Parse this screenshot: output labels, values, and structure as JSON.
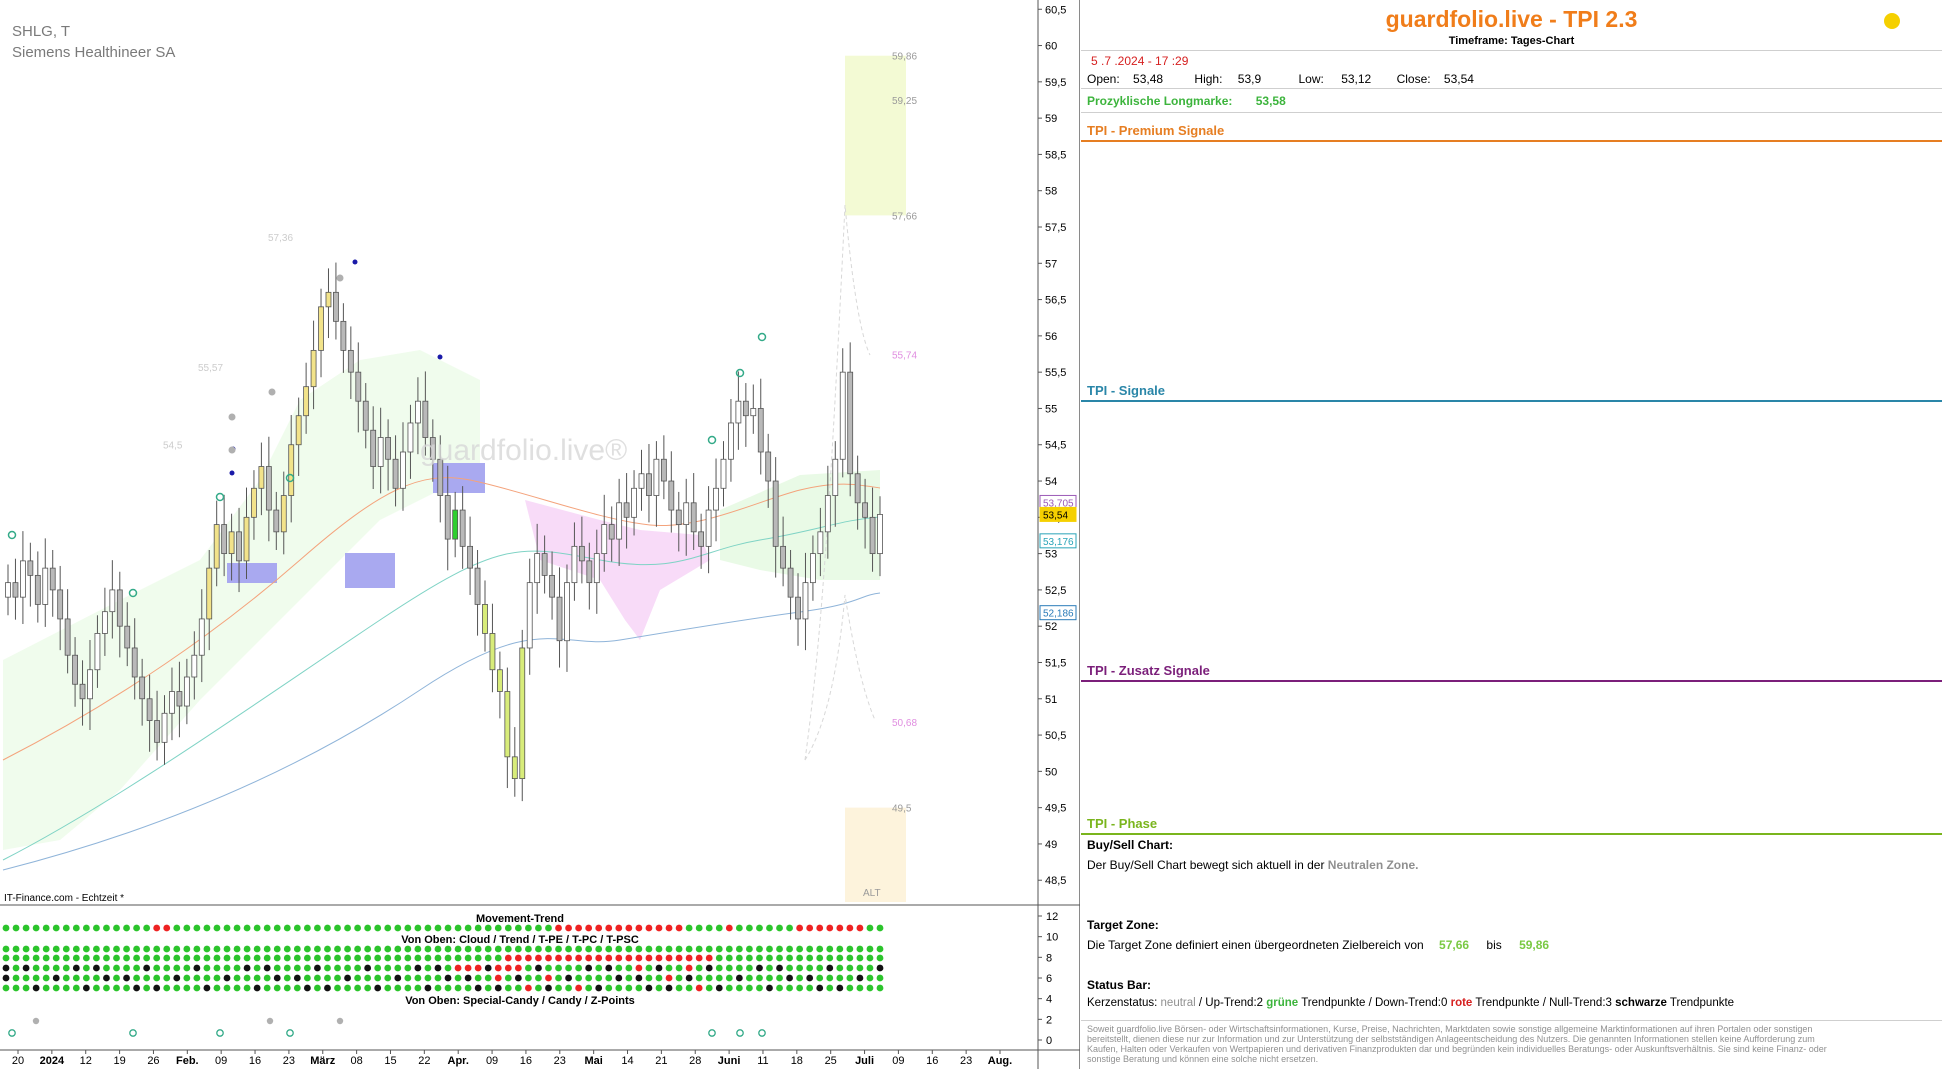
{
  "chart_header": {
    "symbol": "SHLG, T",
    "name": "Siemens Healthineer SA",
    "watermark": "guardfolio.live®",
    "source": "IT-Finance.com - Echtzeit *",
    "alt_label": "ALT"
  },
  "chart_data": {
    "type": "candlestick",
    "ylim": [
      48.2,
      60.6
    ],
    "y_ticks": [
      "60,5",
      "60",
      "59,5",
      "59",
      "58,5",
      "58",
      "57,5",
      "57",
      "56,5",
      "56",
      "55,5",
      "55",
      "54,5",
      "54",
      "53,5",
      "53",
      "52,5",
      "52",
      "51,5",
      "51",
      "50,5",
      "50",
      "49,5",
      "49",
      "48,5"
    ],
    "x_labels": [
      "20",
      "2024",
      "12",
      "19",
      "26",
      "Feb.",
      "09",
      "16",
      "23",
      "März",
      "08",
      "15",
      "22",
      "Apr.",
      "09",
      "16",
      "23",
      "Mai",
      "14",
      "21",
      "28",
      "Juni",
      "11",
      "18",
      "25",
      "Juli",
      "09",
      "16",
      "23",
      "Aug."
    ],
    "price_tags": [
      {
        "value": 53.705,
        "label": "53,705",
        "color": "#9b59b6"
      },
      {
        "value": 53.54,
        "label": "53,54",
        "color": "#f5d000"
      },
      {
        "value": 53.176,
        "label": "53,176",
        "color": "#2aa4b8"
      },
      {
        "value": 52.186,
        "label": "52,186",
        "color": "#2a7bb8"
      }
    ],
    "level_labels": [
      {
        "value": 59.86,
        "label": "59,86",
        "color": "#9a9a9a"
      },
      {
        "value": 59.25,
        "label": "59,25",
        "color": "#9a9a9a"
      },
      {
        "value": 57.66,
        "label": "57,66",
        "color": "#9a9a9a"
      },
      {
        "value": 57.36,
        "label": "57,36",
        "color": "#cccccc"
      },
      {
        "value": 55.74,
        "label": "55,74",
        "color": "#e08ee0"
      },
      {
        "value": 55.57,
        "label": "55,57",
        "color": "#cccccc"
      },
      {
        "value": 54.5,
        "label": "54,5",
        "color": "#cccccc"
      },
      {
        "value": 50.68,
        "label": "50,68",
        "color": "#e08ee0"
      },
      {
        "value": 49.5,
        "label": "49,5",
        "color": "#9a9a9a"
      }
    ],
    "candles_close": [
      52.6,
      52.4,
      52.9,
      52.7,
      52.3,
      52.8,
      52.5,
      52.1,
      51.6,
      51.2,
      51.0,
      51.4,
      51.9,
      52.2,
      52.5,
      52.0,
      51.7,
      51.3,
      51.0,
      50.7,
      50.4,
      50.8,
      51.1,
      50.9,
      51.3,
      51.6,
      52.1,
      52.8,
      53.4,
      53.0,
      53.3,
      52.9,
      53.5,
      53.9,
      54.2,
      53.6,
      53.3,
      53.8,
      54.5,
      54.9,
      55.3,
      55.8,
      56.4,
      56.6,
      56.2,
      55.8,
      55.5,
      55.1,
      54.7,
      54.2,
      54.6,
      54.3,
      53.9,
      54.4,
      54.8,
      55.1,
      54.6,
      54.3,
      53.8,
      53.2,
      53.6,
      53.1,
      52.8,
      52.3,
      51.9,
      51.4,
      51.1,
      50.2,
      49.9,
      51.7,
      52.6,
      53.0,
      52.7,
      52.4,
      51.8,
      52.6,
      53.1,
      52.9,
      52.6,
      53.0,
      53.4,
      53.2,
      53.7,
      53.5,
      53.9,
      54.1,
      53.8,
      54.3,
      54.0,
      53.6,
      53.4,
      53.7,
      53.3,
      53.1,
      53.6,
      53.9,
      54.3,
      54.8,
      55.1,
      54.9,
      55.0,
      54.4,
      54.0,
      53.1,
      52.8,
      52.4,
      52.1,
      52.6,
      53.0,
      53.3,
      53.8,
      54.3,
      55.5,
      54.1,
      53.7,
      53.5,
      53.0,
      53.54
    ]
  },
  "indicator": {
    "title_top": "Movement-Trend",
    "title_mid": "Von Oben: Cloud / Trend / T-PE / T-PC / T-PSC",
    "title_bottom": "Von Oben: Special-Candy / Candy / Z-Points",
    "y_ticks": [
      "12",
      "10",
      "8",
      "6",
      "4",
      "2",
      "0"
    ]
  },
  "info": {
    "brand": "guardfolio.live - TPI 2.3",
    "timeframe": "Timeframe: Tages-Chart",
    "datetime": "5 .7 .2024 - 17 :29",
    "open_label": "Open:",
    "open": "53,48",
    "high_label": "High:",
    "high": "53,9",
    "low_label": "Low:",
    "low": "53,12",
    "close_label": "Close:",
    "close": "53,54",
    "longmarke_label": "Prozyklische Longmarke:",
    "longmarke": "53,58",
    "premium_title": "TPI - Premium Signale",
    "signale_title": "TPI - Signale",
    "zusatz_title": "TPI - Zusatz Signale",
    "phase_title": "TPI - Phase",
    "buysell_title": "Buy/Sell Chart:",
    "buysell_text": "Der Buy/Sell Chart bewegt sich aktuell in der",
    "buysell_zone": "Neutralen Zone.",
    "target_title": "Target Zone:",
    "target_text": "Die Target Zone definiert einen übergeordneten Zielbereich von",
    "target_from": "57,66",
    "target_bis": "bis",
    "target_to": "59,86",
    "status_title": "Status Bar:",
    "status_kerzen": "Kerzenstatus:",
    "status_neutral": "neutral",
    "status_up": "/ Up-Trend:2",
    "status_green": "grüne",
    "status_tp1": "Trendpunkte",
    "status_down": "/ Down-Trend:0",
    "status_red": "rote",
    "status_tp2": "Trendpunkte",
    "status_null": "/ Null-Trend:3",
    "status_black": "schwarze",
    "status_tp3": "Trendpunkte",
    "disclaimer": "Soweit guardfolio.live Börsen- oder Wirtschaftsinformationen, Kurse, Preise, Nachrichten, Marktdaten sowie sonstige allgemeine Marktinformationen auf ihren Portalen oder sonstigen bereitstellt, dienen diese nur zur Information und zur Unterstützung der selbstständigen Anlageentscheidung des Nutzers. Die genannten Informationen stellen keine Aufforderung zum Kaufen, Halten oder Verkaufen von Wertpapieren und derivativen Finanzprodukten dar und begründen kein individuelles Beratungs- oder Auskunftsverhältnis. Sie sind keine Finanz- oder sonstige Beratung und können eine solche nicht ersetzen.",
    "colors": {
      "brand": "#f07d1a",
      "premium": "#e67e22",
      "signale": "#2a86a8",
      "zusatz": "#7b1f7a",
      "phase": "#7ab51d",
      "green": "#3cb43c",
      "red": "#d62020"
    }
  }
}
